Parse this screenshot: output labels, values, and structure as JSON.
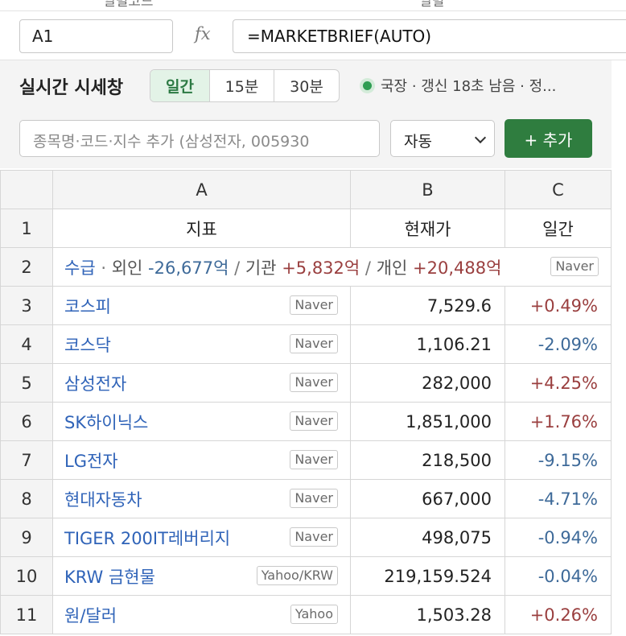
{
  "top_labels": [
    "일별코드",
    "일별"
  ],
  "formula_bar": {
    "name_box": "A1",
    "fx_label": "fx",
    "formula": "=MARKETBRIEF(AUTO)"
  },
  "panel": {
    "title": "실시간 시세창",
    "ranges": [
      "일간",
      "15분",
      "30분"
    ],
    "selected_range": "일간",
    "status": "국장 · 갱신 18초 남음 · 정...",
    "search_placeholder": "종목명·코드·지수 추가 (삼성전자, 005930",
    "select_value": "자동",
    "add_button": "+ 추가"
  },
  "sheet": {
    "columns": [
      "A",
      "B",
      "C"
    ],
    "header_row": {
      "num": "1",
      "a": "지표",
      "b": "현재가",
      "c": "일간"
    },
    "flow_row": {
      "num": "2",
      "label": "수급",
      "foreign_label": "외인",
      "foreign_value": "-26,677억",
      "inst_label": "기관",
      "inst_value": "+5,832억",
      "indiv_label": "개인",
      "indiv_value": "+20,488억",
      "source": "Naver"
    },
    "rows": [
      {
        "num": "3",
        "name": "코스피",
        "source": "Naver",
        "price": "7,529.6",
        "change": "+0.49%"
      },
      {
        "num": "4",
        "name": "코스닥",
        "source": "Naver",
        "price": "1,106.21",
        "change": "-2.09%"
      },
      {
        "num": "5",
        "name": "삼성전자",
        "source": "Naver",
        "price": "282,000",
        "change": "+4.25%"
      },
      {
        "num": "6",
        "name": "SK하이닉스",
        "source": "Naver",
        "price": "1,851,000",
        "change": "+1.76%"
      },
      {
        "num": "7",
        "name": "LG전자",
        "source": "Naver",
        "price": "218,500",
        "change": "-9.15%"
      },
      {
        "num": "8",
        "name": "현대자동차",
        "source": "Naver",
        "price": "667,000",
        "change": "-4.71%"
      },
      {
        "num": "9",
        "name": "TIGER 200IT레버리지",
        "source": "Naver",
        "price": "498,075",
        "change": "-0.94%"
      },
      {
        "num": "10",
        "name": "KRW 금현물",
        "source": "Yahoo/KRW",
        "price": "219,159.524",
        "change": "-0.04%"
      },
      {
        "num": "11",
        "name": "원/달러",
        "source": "Yahoo",
        "price": "1,503.28",
        "change": "+0.26%"
      }
    ]
  },
  "colors": {
    "accent_green": "#2f7d3f",
    "positive": "#9a3f3f",
    "negative": "#3e6a99",
    "link_blue": "#2f63b8"
  }
}
